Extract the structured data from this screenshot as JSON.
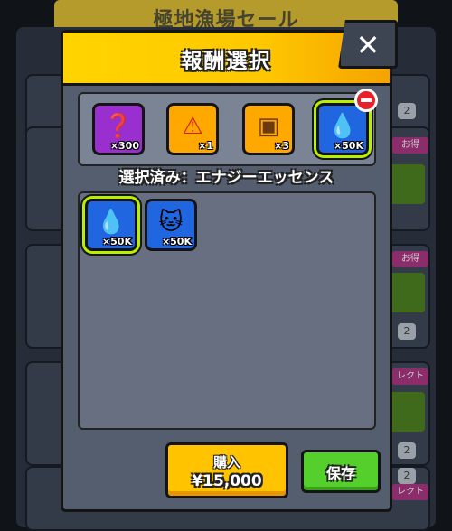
{
  "background": {
    "title": "極地漁場セール",
    "side_numbers": [
      "2",
      "2",
      "2",
      "2"
    ],
    "side_badges": [
      "お得",
      "お得",
      "レクト",
      "レクト"
    ]
  },
  "modal": {
    "title": "報酬選択",
    "close_icon": "close-icon"
  },
  "reward_slots": [
    {
      "icon": "mystery-fish-icon",
      "glyph": "❓",
      "color": "#9a2fd0",
      "qty": "×300"
    },
    {
      "icon": "warning-triangle-icon",
      "glyph": "⚠",
      "color": "#ffa800",
      "qty": "×1"
    },
    {
      "icon": "treasure-chest-icon",
      "glyph": "▣",
      "color": "#ffa800",
      "qty": "×3"
    },
    {
      "icon": "energy-essence-icon",
      "glyph": "💧",
      "color": "#1f66e0",
      "qty": "×50K",
      "selected": true
    }
  ],
  "selected_label": "選択済み：エナジーエッセンス",
  "choices": [
    {
      "icon": "energy-essence-icon",
      "glyph": "💧",
      "color": "#1f66e0",
      "qty": "×50K",
      "selected": true
    },
    {
      "icon": "cat-face-icon",
      "glyph": "🐱",
      "color": "#1f66e0",
      "qty": "×50K"
    }
  ],
  "buttons": {
    "buy_label": "購入",
    "buy_price": "¥15,000",
    "save_label": "保存"
  }
}
